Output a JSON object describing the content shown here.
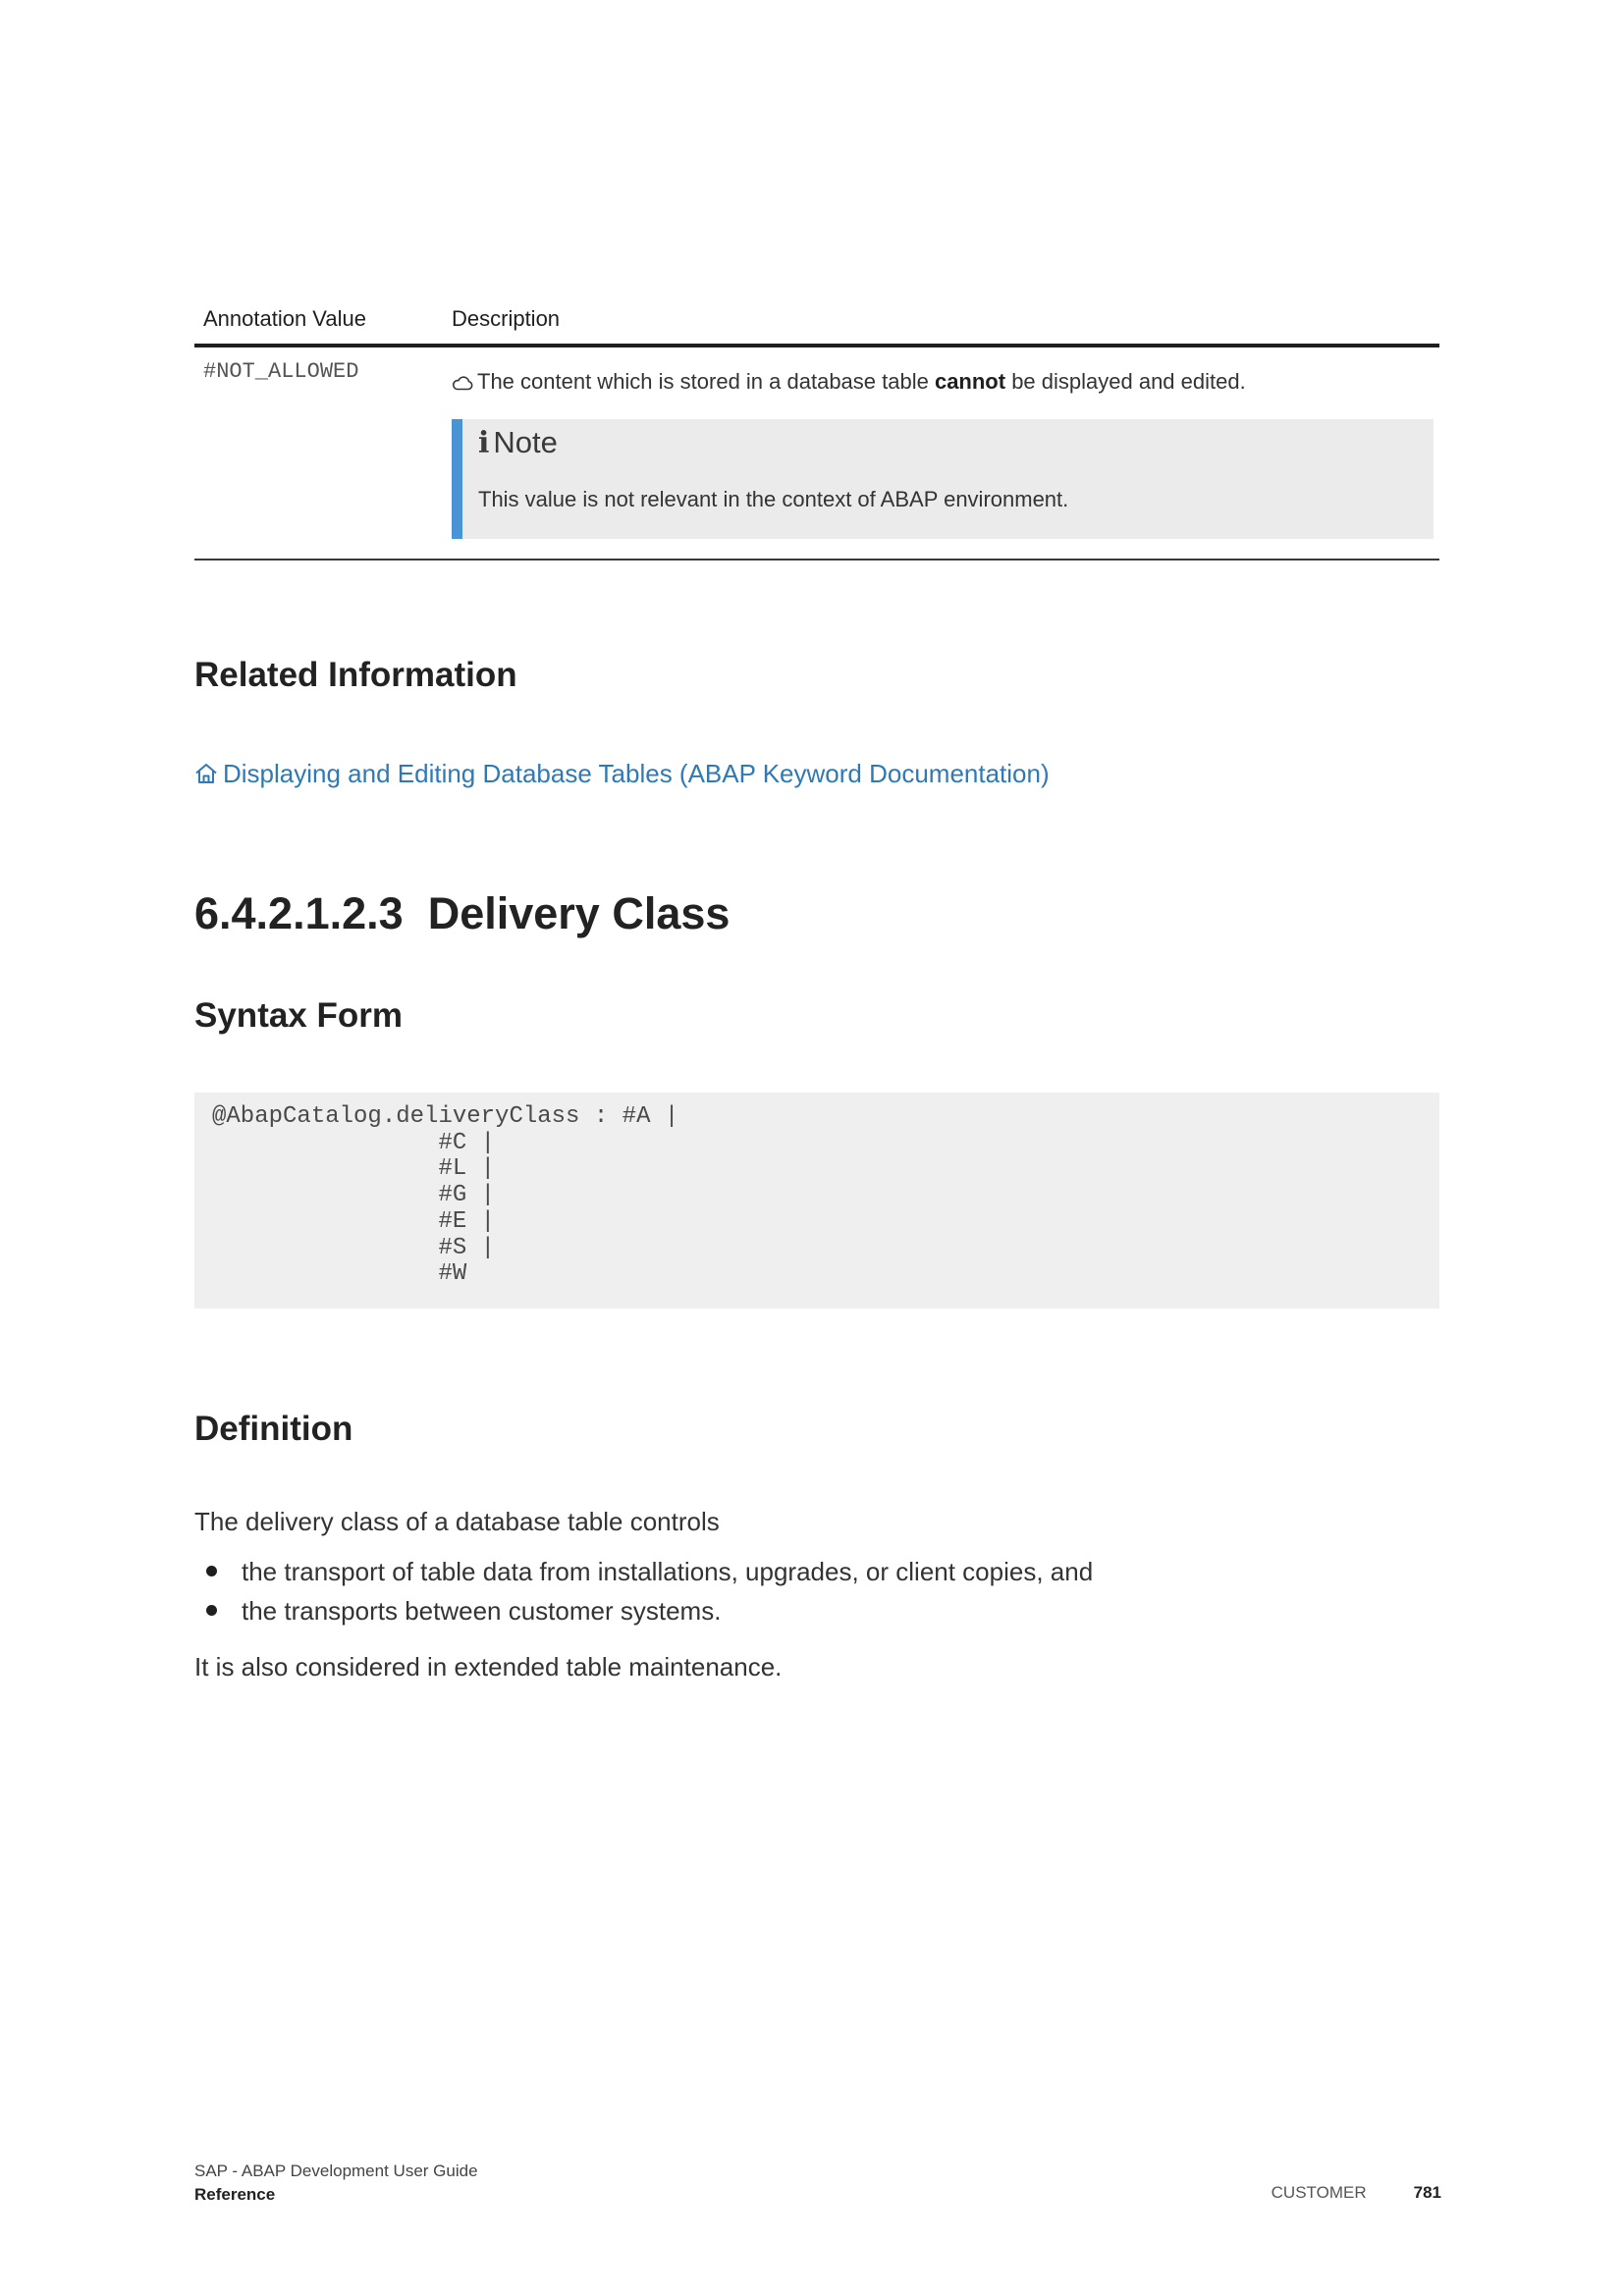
{
  "table": {
    "headers": [
      "Annotation Value",
      "Description"
    ],
    "rows": [
      {
        "value": "#NOT_ALLOWED",
        "description_before": "The content which is stored in a database table ",
        "description_bold": "cannot",
        "description_after": " be displayed and edited.",
        "description_icon": "cloud-icon",
        "note": {
          "icon": "info-icon",
          "glyph": "i",
          "title": "Note",
          "text": "This value is not relevant in the context of ABAP environment."
        }
      }
    ]
  },
  "related": {
    "heading": "Related Information",
    "link_icon": "home-icon",
    "link_text": "Displaying and Editing Database Tables (ABAP Keyword Documentation)",
    "link_color": "#2f79b5"
  },
  "section": {
    "number": "6.4.2.1.2.3",
    "title": "Delivery Class"
  },
  "syntax": {
    "heading": "Syntax Form",
    "code": "@AbapCatalog.deliveryClass : #A |\n                #C |\n                #L |\n                #G |\n                #E |\n                #S |\n                #W"
  },
  "definition": {
    "heading": "Definition",
    "intro": "The delivery class of a database table controls",
    "items": [
      "the transport of table data from installations, upgrades, or client copies, and",
      "the transports between customer systems."
    ],
    "outro": "It is also considered in extended table maintenance."
  },
  "footer": {
    "doc_title": "SAP - ABAP Development User Guide",
    "section": "Reference",
    "audience": "CUSTOMER",
    "page": "781"
  },
  "colors": {
    "note_accent": "#4a93d4",
    "note_background": "#ebebeb",
    "code_background": "#efefef"
  }
}
